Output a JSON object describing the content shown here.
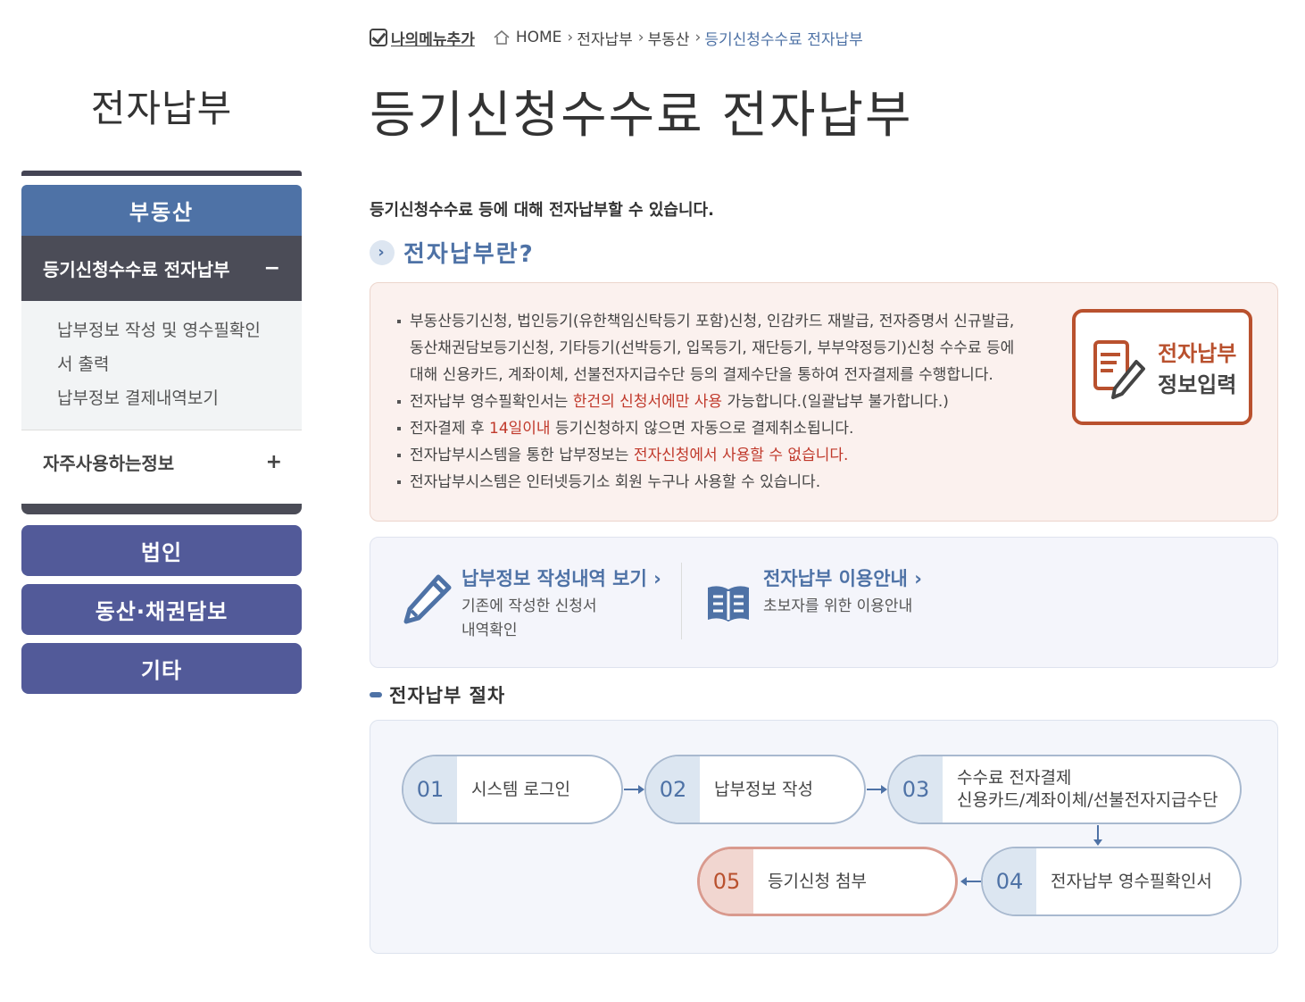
{
  "sidebar": {
    "title": "전자납부",
    "category_active": "부동산",
    "sub_active": "등기신청수수료 전자납부",
    "sub_active_toggle": "−",
    "sub_links": [
      "납부정보 작성 및 영수필확인",
      "서 출력",
      "납부정보 결제내역보기"
    ],
    "sub_item2": "자주사용하는정보",
    "sub_item2_toggle": "+",
    "categories": [
      "법인",
      "동산·채권담보",
      "기타"
    ]
  },
  "breadcrumb": {
    "mymenu": "나의메뉴추가",
    "items": [
      "HOME",
      "전자납부",
      "부동산",
      "등기신청수수료 전자납부"
    ]
  },
  "page_title": "등기신청수수료 전자납부",
  "intro": "등기신청수수료 등에 대해 전자납부할 수 있습니다.",
  "section1": {
    "title": "전자납부란?",
    "lines": [
      {
        "a": "부동산등기신청, 법인등기(유한책임신탁등기 포함)신청, 인감카드 재발급, 전자증명서 신규발급,"
      },
      {
        "a": "동산채권담보등기신청, 기타등기(선박등기, 입목등기, 재단등기, 부부약정등기)신청 수수료 등에"
      },
      {
        "a": "대해 신용카드, 계좌이체, 선불전자지급수단 등의 결제수단을 통하여 전자결제를 수행합니다."
      }
    ],
    "b2_pre": "전자납부 영수필확인서는 ",
    "b2_red": "한건의 신청서에만 사용",
    "b2_post": " 가능합니다.(일괄납부 불가합니다.)",
    "b3_pre": "전자결제 후 ",
    "b3_red": "14일이내",
    "b3_post": " 등기신청하지 않으면 자동으로 결제취소됩니다.",
    "b4_pre": "전자납부시스템을 통한 납부정보는 ",
    "b4_red": "전자신청에서 사용할 수 없습니다.",
    "b5": "전자납부시스템은 인터넷등기소 회원 누구나 사용할 수 있습니다.",
    "button_l1": "전자납부",
    "button_l2": "정보입력"
  },
  "links": {
    "a_title": "납부정보 작성내역 보기",
    "a_desc1": "기존에 작성한 신청서",
    "a_desc2": "내역확인",
    "b_title": "전자납부 이용안내",
    "b_desc": "초보자를 위한 이용안내"
  },
  "section2": {
    "title": "전자납부 절차",
    "steps": [
      {
        "num": "01",
        "label": "시스템 로그인"
      },
      {
        "num": "02",
        "label": "납부정보 작성"
      },
      {
        "num": "03",
        "label": "수수료 전자결제",
        "label2": "신용카드/계좌이체/선불전자지급수단"
      },
      {
        "num": "04",
        "label": "전자납부 영수필확인서"
      },
      {
        "num": "05",
        "label": "등기신청 첨부"
      }
    ]
  },
  "colors": {
    "primary": "#4e72a6",
    "dark": "#4b4c57",
    "accent": "#b9512e",
    "category": "#525a99"
  }
}
